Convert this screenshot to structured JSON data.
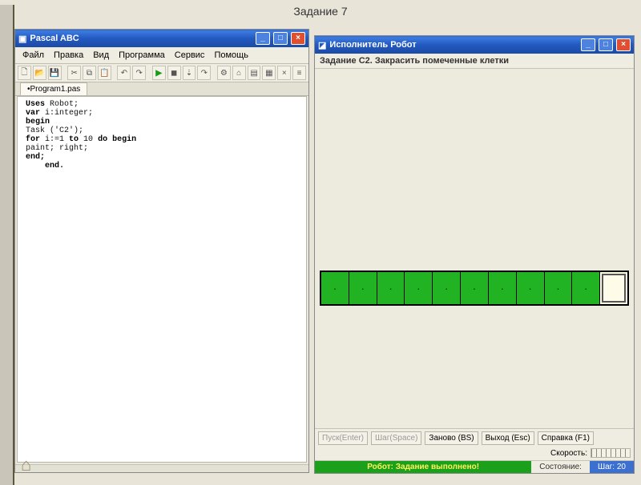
{
  "page_title": "Задание 7",
  "pascal": {
    "window_title": "Pascal ABC",
    "menus": [
      "Файл",
      "Правка",
      "Вид",
      "Программа",
      "Сервис",
      "Помощь"
    ],
    "tab": "•Program1.pas",
    "code": {
      "l1a": "Uses ",
      "l1b": "Robot;",
      "l2a": "var ",
      "l2b": "i:integer;",
      "l3": "begin",
      "l4": "Task ('C2');",
      "l5a": "for ",
      "l5b": "i:=1 ",
      "l5c": "to ",
      "l5d": "10 ",
      "l5e": "do begin",
      "l6": "paint; right;",
      "l7": "end;",
      "l8": "    end."
    }
  },
  "robot": {
    "window_title": "Исполнитель Робот",
    "task": "Задание C2. Закрасить помеченные клетки",
    "cells": [
      "painted",
      "painted",
      "painted",
      "painted",
      "painted",
      "painted",
      "painted",
      "painted",
      "painted",
      "painted",
      "robot"
    ],
    "buttons": {
      "start": "Пуск(Enter)",
      "step": "Шаг(Space)",
      "again": "Заново (BS)",
      "exit": "Выход (Esc)",
      "help": "Справка (F1)"
    },
    "speed_label": "Скорость:",
    "status_done": "Робот: Задание выполнено!",
    "state_label": "Состояние:",
    "steps_label": "Шаг: 20"
  }
}
